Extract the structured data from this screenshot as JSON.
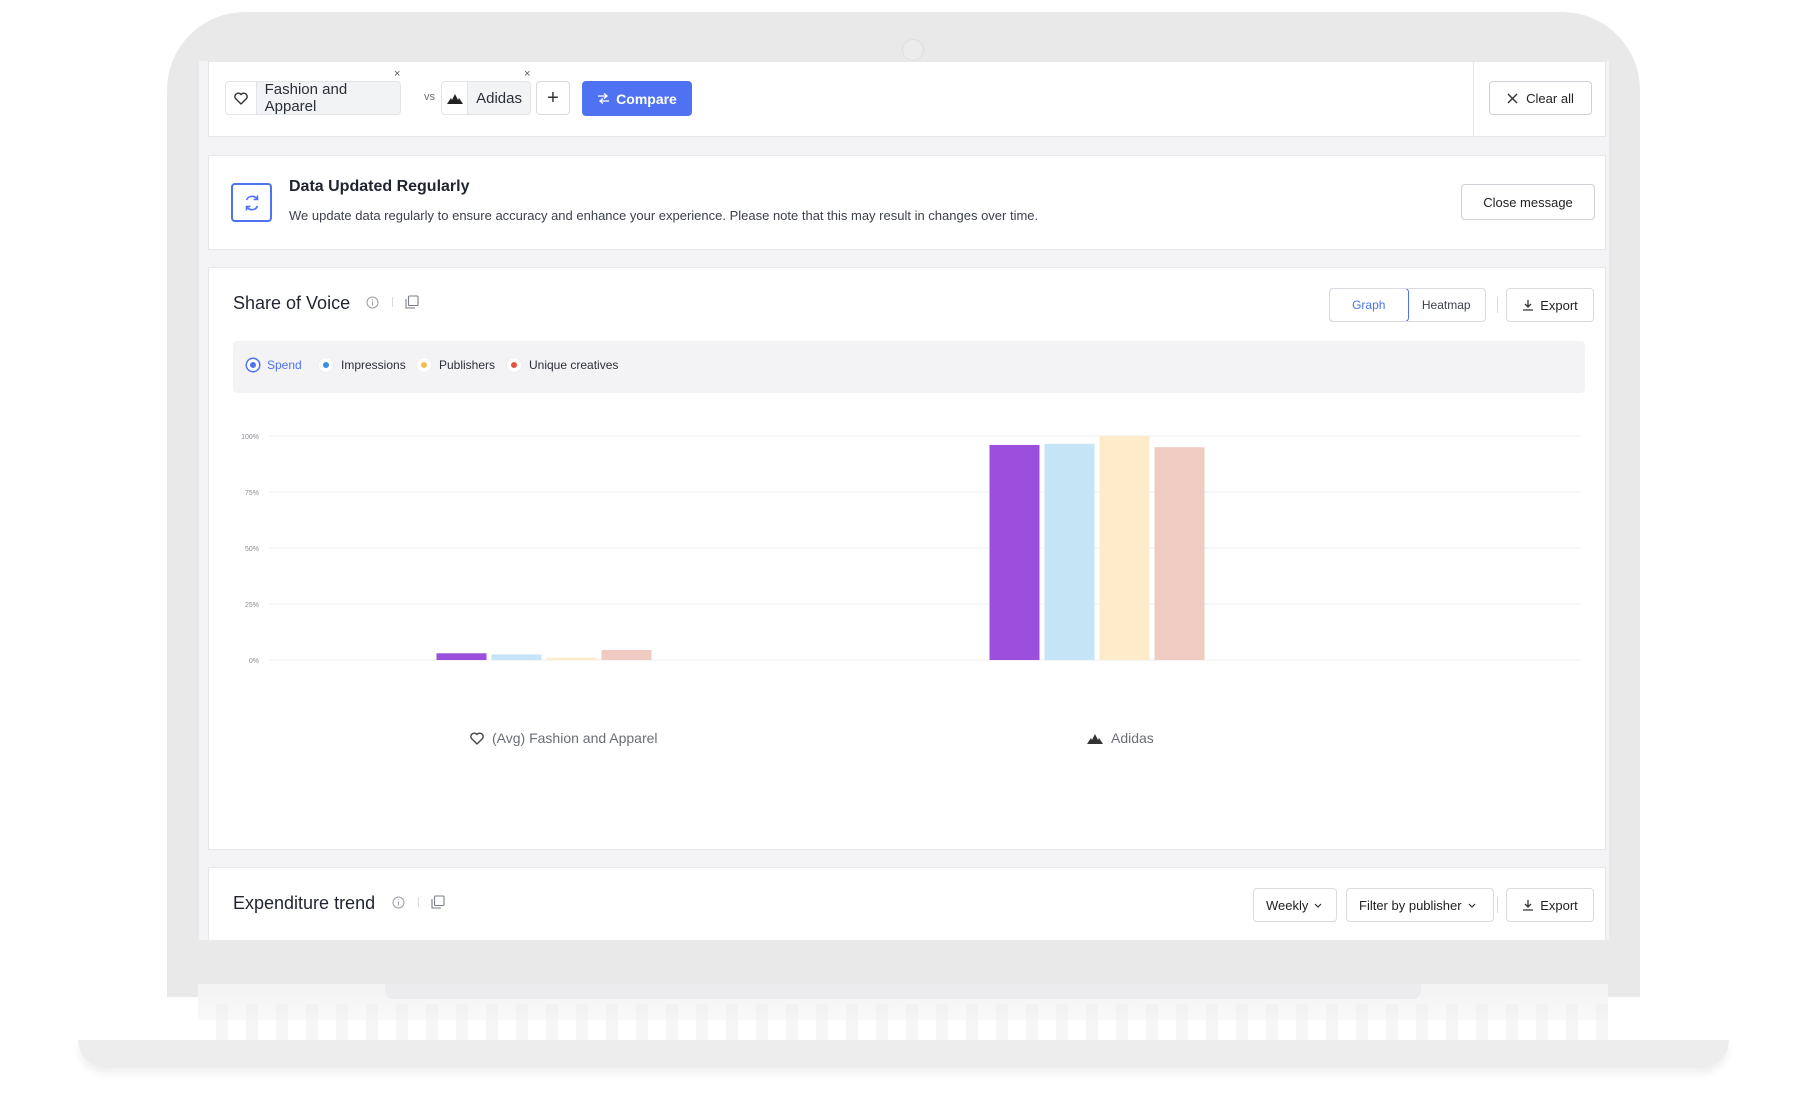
{
  "compare": {
    "chips": [
      {
        "label": "Fashion and Apparel",
        "icon": "heart-icon"
      },
      {
        "label": "Adidas",
        "icon": "adidas-logo-icon"
      }
    ],
    "remove_glyph": "×",
    "vs": "vs",
    "add_label": "+",
    "compare_label": "Compare",
    "clear_label": "Clear all"
  },
  "notice": {
    "title": "Data Updated Regularly",
    "text": "We update data regularly to ensure accuracy and enhance your experience. Please note that this may result in changes over time.",
    "close_label": "Close message"
  },
  "share_of_voice": {
    "title": "Share of Voice",
    "view_options": [
      "Graph",
      "Heatmap"
    ],
    "active_view": "Graph",
    "export_label": "Export",
    "metrics": [
      {
        "label": "Spend",
        "color": "#9b4fdc",
        "active": true
      },
      {
        "label": "Impressions",
        "color": "#c5e4f6",
        "active": false
      },
      {
        "label": "Publishers",
        "color": "#fdebc9",
        "active": false
      },
      {
        "label": "Unique creatives",
        "color": "#efcbc1",
        "active": false
      }
    ]
  },
  "chart_data": {
    "type": "bar",
    "categories": [
      "(Avg) Fashion and Apparel",
      "Adidas"
    ],
    "category_icons": [
      "heart-icon",
      "adidas-logo-icon"
    ],
    "series": [
      {
        "name": "Spend",
        "values": [
          3,
          96
        ],
        "color": "#9b4fdc"
      },
      {
        "name": "Impressions",
        "values": [
          2.5,
          96.5
        ],
        "color": "#c5e4f6"
      },
      {
        "name": "Publishers",
        "values": [
          1,
          100
        ],
        "color": "#fdebc9"
      },
      {
        "name": "Unique creatives",
        "values": [
          4.5,
          95
        ],
        "color": "#efcbc1"
      }
    ],
    "yticks": [
      "0%",
      "25%",
      "50%",
      "75%",
      "100%"
    ],
    "ylim": [
      0,
      100
    ],
    "grid": true
  },
  "expenditure": {
    "title": "Expenditure trend",
    "period_label": "Weekly",
    "filter_label": "Filter by publisher",
    "export_label": "Export"
  }
}
